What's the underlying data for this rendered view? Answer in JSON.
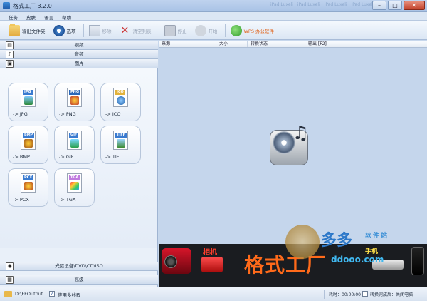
{
  "window": {
    "title": "格式工厂 3.2.0",
    "minimize": "–",
    "maximize": "□",
    "close": "✕",
    "ghost_tabs": [
      "iPad Luxeli",
      "iPad Luxeli",
      "iPad Luxeli",
      "iPad Luxeli"
    ]
  },
  "menu": [
    "任务",
    "皮肤",
    "语言",
    "帮助"
  ],
  "toolbar": {
    "output_folder": "输出文件夹",
    "options": "选项",
    "remove": "移除",
    "clear_list": "清空列表",
    "stop": "停止",
    "start": "开始",
    "wps": "WPS 办公软件"
  },
  "sidebar": {
    "categories": {
      "video": "视频",
      "audio": "音频",
      "picture": "图片",
      "rom": "光驱设备\\DVD\\CD\\ISO",
      "advanced": "高级"
    },
    "formats": [
      {
        "badge": "JPG",
        "label": "-> JPG",
        "color": "#3a7bd0"
      },
      {
        "badge": "PNG",
        "label": "-> PNG",
        "color": "#2a67b8"
      },
      {
        "badge": "ICO",
        "label": "-> ICO",
        "color": "#e2b23a"
      },
      {
        "badge": "BMP",
        "label": "-> BMP",
        "color": "#3a7bd0"
      },
      {
        "badge": "GIF",
        "label": "-> GIF",
        "color": "#3a7bd0"
      },
      {
        "badge": "TIFF",
        "label": "-> TIF",
        "color": "#3a7bd0"
      },
      {
        "badge": "PCX",
        "label": "-> PCX",
        "color": "#3a7bd0"
      },
      {
        "badge": "TGA",
        "label": "-> TGA",
        "color": "#c07adf"
      }
    ]
  },
  "table": {
    "columns": [
      "来源",
      "大小",
      "转换状态",
      "输出 [F2]"
    ]
  },
  "banner": {
    "camera_label": "相机",
    "slogan": "格式工厂",
    "phone_label": "手机"
  },
  "watermark": {
    "big": "多多",
    "small": "软件站",
    "domain": "ddooo.com"
  },
  "status": {
    "output_path": "D:\\FFOutput",
    "multithread_check": "✓",
    "multithread": "使用多线程",
    "elapsed": "耗时：00:00:00",
    "after_done": "转换完成后：",
    "shutdown": "关闭电脑"
  }
}
